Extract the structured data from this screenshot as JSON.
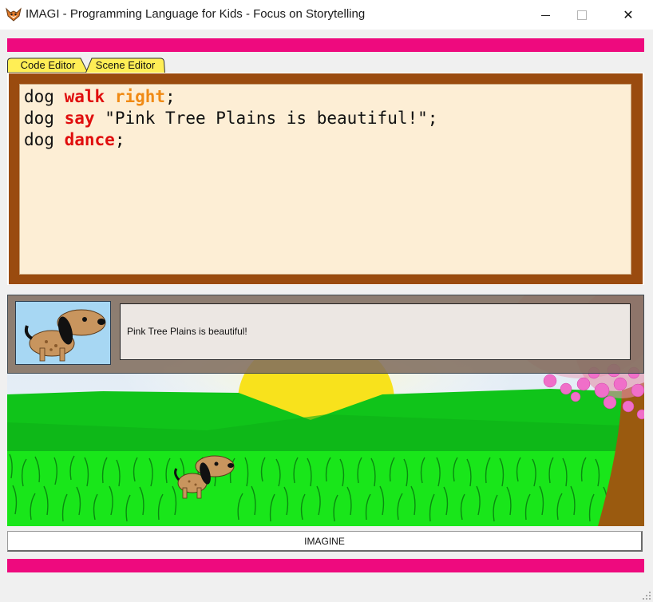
{
  "window": {
    "title": "IMAGI - Programming Language for Kids - Focus on Storytelling",
    "icon": "fox-app-icon",
    "controls": [
      "minimize-icon",
      "maximize-icon",
      "close-icon"
    ],
    "close_glyph": "✕"
  },
  "tabs": [
    {
      "label": "Code Editor",
      "active": true
    },
    {
      "label": "Scene Editor",
      "active": false
    }
  ],
  "code": [
    {
      "subject": "dog",
      "action": "walk",
      "arg": "right",
      "end": ";"
    },
    {
      "subject": "dog",
      "action": "say",
      "arg": "\"Pink Tree Plains is beautiful!\"",
      "end": ";"
    },
    {
      "subject": "dog",
      "action": "dance",
      "end": ";"
    }
  ],
  "scene": {
    "speech_text": "Pink Tree Plains is beautiful!",
    "character": "dog",
    "background": "pink-tree-plains"
  },
  "imagine_button": "IMAGINE",
  "colors": {
    "accent_bar": "#ee0a7e",
    "editor_frame": "#9a4b0f",
    "editor_paper": "#fdeed5",
    "tab": "#ffee55",
    "keyword_action": "#e00d0d",
    "keyword_arg": "#f08a14"
  }
}
